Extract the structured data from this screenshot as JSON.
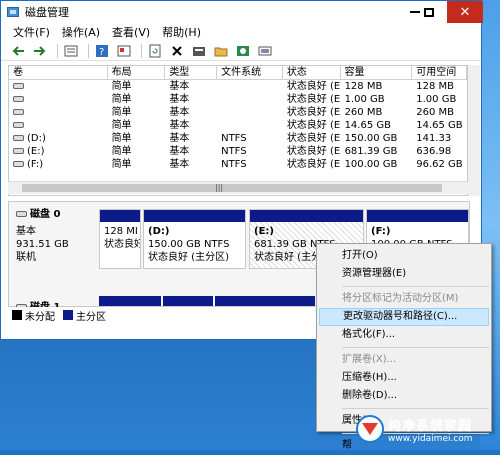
{
  "window": {
    "title": "磁盘管理"
  },
  "menu": [
    "文件(F)",
    "操作(A)",
    "查看(V)",
    "帮助(H)"
  ],
  "toolbar_icons": [
    "back-arrow-icon",
    "forward-arrow-icon",
    "list-view-icon",
    "help-icon",
    "properties-icon",
    "refresh-icon",
    "delete-icon",
    "settings-icon",
    "open-folder-icon",
    "search-icon",
    "volume-icon"
  ],
  "volume_table": {
    "headers": [
      "卷",
      "布局",
      "类型",
      "文件系统",
      "状态",
      "容量",
      "可用空间"
    ],
    "rows": [
      [
        "",
        "简单",
        "基本",
        "",
        "状态良好 (E",
        "128 MB",
        "128 MB"
      ],
      [
        "",
        "简单",
        "基本",
        "",
        "状态良好 (E",
        "1.00 GB",
        "1.00 GB"
      ],
      [
        "",
        "简单",
        "基本",
        "",
        "状态良好 (E",
        "260 MB",
        "260 MB"
      ],
      [
        "",
        "简单",
        "基本",
        "",
        "状态良好 (E",
        "14.65 GB",
        "14.65 GB"
      ],
      [
        "(D:)",
        "简单",
        "基本",
        "NTFS",
        "状态良好 (E",
        "150.00 GB",
        "141.33"
      ],
      [
        "(E:)",
        "简单",
        "基本",
        "NTFS",
        "状态良好 (E",
        "681.39 GB",
        "636.98"
      ],
      [
        "(F:)",
        "简单",
        "基本",
        "NTFS",
        "状态良好 (E",
        "100.00 GB",
        "96.62 GB"
      ]
    ]
  },
  "disk0": {
    "name": "磁盘 0",
    "type": "基本",
    "size": "931.51 GB",
    "status": "联机",
    "partitions": [
      {
        "title": "",
        "size": "128 MI",
        "status": "状态良好"
      },
      {
        "title": "(D:)",
        "size": "150.00 GB NTFS",
        "status": "状态良好 (主分区)"
      },
      {
        "title": "(E:)",
        "size": "681.39 GB NTFS",
        "status": "状态良好 (主分区)"
      },
      {
        "title": "(F:)",
        "size": "100.00 GB NTFS",
        "status": ""
      }
    ]
  },
  "disk1": {
    "name": "磁盘 1"
  },
  "legend": [
    "未分配",
    "主分区"
  ],
  "legend_colors": [
    "#000000",
    "#0c1a8a"
  ],
  "context_menu": [
    {
      "label": "打开(O)",
      "enabled": true
    },
    {
      "label": "资源管理器(E)",
      "enabled": true
    },
    {
      "sep": true
    },
    {
      "label": "将分区标记为活动分区(M)",
      "enabled": false
    },
    {
      "label": "更改驱动器号和路径(C)...",
      "enabled": true,
      "highlight": true
    },
    {
      "label": "格式化(F)...",
      "enabled": true
    },
    {
      "sep": true
    },
    {
      "label": "扩展卷(X)...",
      "enabled": false
    },
    {
      "label": "压缩卷(H)...",
      "enabled": true
    },
    {
      "label": "删除卷(D)...",
      "enabled": true
    },
    {
      "sep": true
    },
    {
      "label": "属性(P)",
      "enabled": true
    },
    {
      "sep": true
    },
    {
      "label": "帮",
      "enabled": true
    }
  ],
  "watermark": {
    "title": "纯净系统家园",
    "url": "www.yidaimei.com"
  }
}
